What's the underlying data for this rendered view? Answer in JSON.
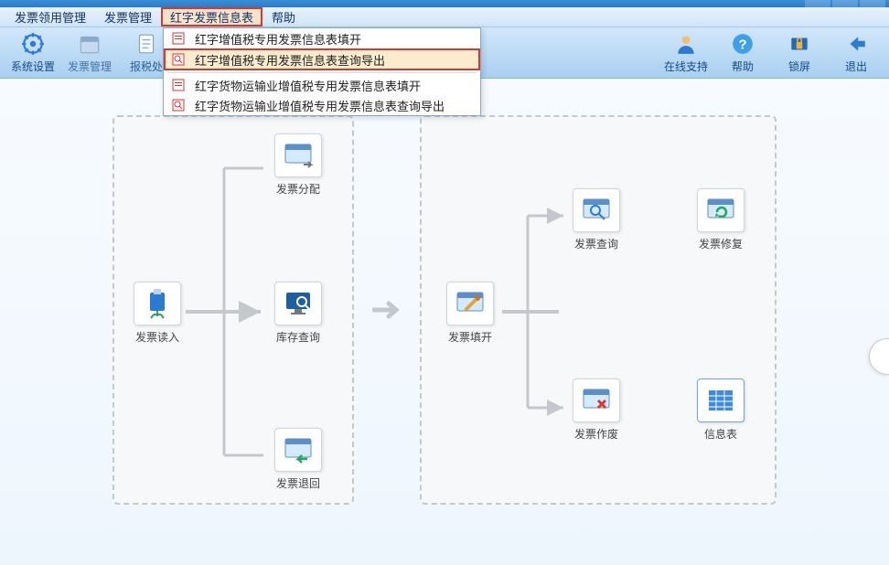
{
  "menu": {
    "items": [
      {
        "label": "发票领用管理"
      },
      {
        "label": "发票管理"
      },
      {
        "label": "红字发票信息表",
        "highlighted": true
      },
      {
        "label": "帮助"
      }
    ]
  },
  "dropdown": {
    "items": [
      {
        "label": "红字增值税专用发票信息表填开",
        "icon": "doc-red"
      },
      {
        "label": "红字增值税专用发票信息表查询导出",
        "icon": "doc-search",
        "highlighted": true
      },
      {
        "label": "红字货物运输业增值税专用发票信息表填开",
        "icon": "doc-red",
        "sep_before": true
      },
      {
        "label": "红字货物运输业增值税专用发票信息表查询导出",
        "icon": "doc-search"
      }
    ]
  },
  "toolbar": {
    "left": [
      {
        "name": "system-settings",
        "label": "系统设置",
        "icon": "gear"
      },
      {
        "name": "invoice-manage",
        "label": "发票管理",
        "icon": "calendar"
      },
      {
        "name": "tax-report",
        "label": "报税处",
        "icon": "doc"
      }
    ],
    "right": [
      {
        "name": "online-support",
        "label": "在线支持",
        "icon": "person"
      },
      {
        "name": "help",
        "label": "帮助",
        "icon": "help"
      },
      {
        "name": "lock",
        "label": "锁屏",
        "icon": "lock"
      },
      {
        "name": "exit",
        "label": "退出",
        "icon": "back"
      }
    ]
  },
  "workspace": {
    "left_panel": {
      "nodes": [
        {
          "name": "invoice-read",
          "label": "发票读入",
          "icon": "usb"
        },
        {
          "name": "invoice-distribute",
          "label": "发票分配",
          "icon": "window"
        },
        {
          "name": "stock-query",
          "label": "库存查询",
          "icon": "monitor-search"
        },
        {
          "name": "invoice-return",
          "label": "发票退回",
          "icon": "window-back"
        }
      ]
    },
    "right_panel": {
      "nodes": [
        {
          "name": "invoice-fill",
          "label": "发票填开",
          "icon": "window-edit"
        },
        {
          "name": "invoice-query",
          "label": "发票查询",
          "icon": "window-search"
        },
        {
          "name": "invoice-repair",
          "label": "发票修复",
          "icon": "window-refresh"
        },
        {
          "name": "invoice-void",
          "label": "发票作废",
          "icon": "window-x"
        },
        {
          "name": "info-table",
          "label": "信息表",
          "icon": "table"
        }
      ]
    }
  }
}
